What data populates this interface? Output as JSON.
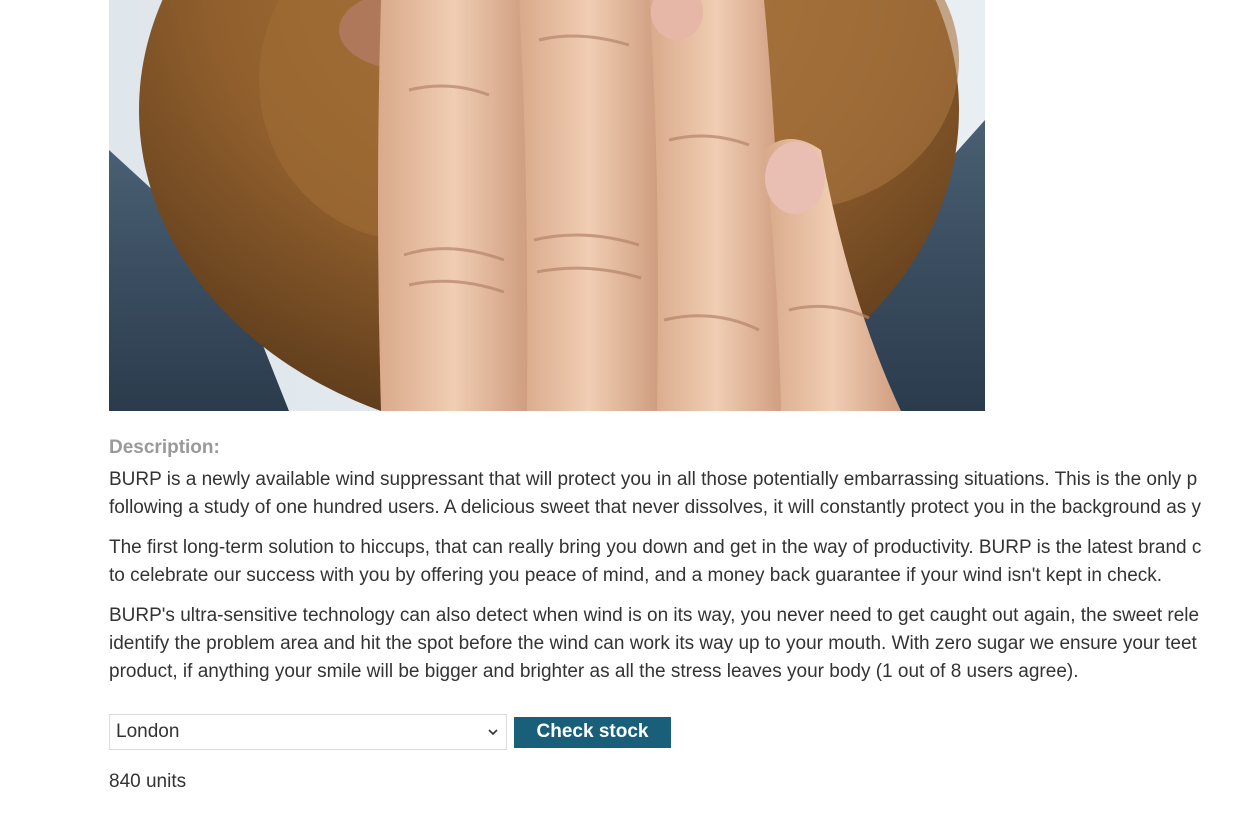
{
  "product": {
    "image_alt": "Man with beard covering mouth with fingers"
  },
  "description": {
    "label": "Description:",
    "paragraphs": [
      {
        "lines": [
          "BURP is a newly available wind suppressant that will protect you in all those potentially embarrassing situations. This is the only p",
          "following a study of one hundred users. A delicious sweet that never dissolves, it will constantly protect you in the background as y"
        ]
      },
      {
        "lines": [
          "The first long-term solution to hiccups, that can really bring you down and get in the way of productivity. BURP is the latest brand c",
          "to celebrate our success with you by offering you peace of mind, and a money back guarantee if your wind isn't kept in check."
        ]
      },
      {
        "lines": [
          "BURP's ultra-sensitive technology can also detect when wind is on its way, you never need to get caught out again, the sweet rele",
          "identify the problem area and hit the spot before the wind can work its way up to your mouth. With zero sugar we ensure your teet",
          "product, if anything your smile will be bigger and brighter as all the stress leaves your body (1 out of 8 users agree)."
        ]
      }
    ]
  },
  "stock_check": {
    "selected_store": "London",
    "button_label": "Check stock",
    "result_text": "840 units"
  },
  "colors": {
    "button_bg": "#1a5f7a",
    "label_gray": "#999999",
    "text": "#333333"
  }
}
